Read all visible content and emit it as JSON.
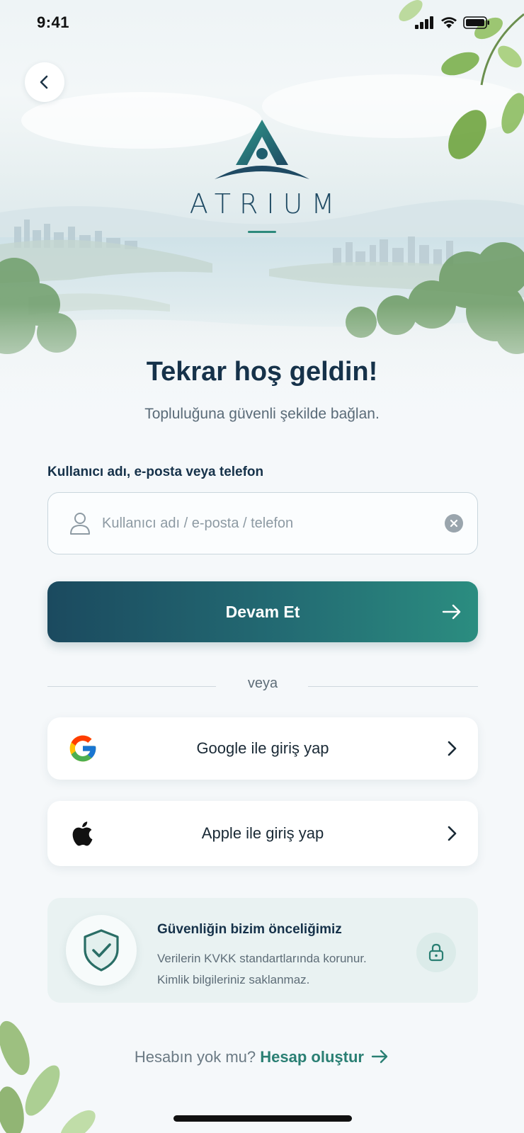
{
  "status_bar": {
    "time": "9:41"
  },
  "brand": {
    "name": "ATRIUM"
  },
  "welcome": {
    "title": "Tekrar hoş geldin!",
    "subtitle": "Topluluğuna güvenli şekilde bağlan."
  },
  "login_field": {
    "label": "Kullanıcı adı, e-posta veya telefon",
    "placeholder": "Kullanıcı adı / e-posta / telefon",
    "value": ""
  },
  "continue_button": {
    "label": "Devam Et"
  },
  "divider": {
    "text": "veya"
  },
  "social": {
    "google_label": "Google ile giriş yap",
    "apple_label": "Apple ile giriş yap"
  },
  "security": {
    "title": "Güvenliğin bizim önceliğimiz",
    "line1": "Verilerin KVKK standartlarında korunur.",
    "line2": "Kimlik bilgileriniz saklanmaz."
  },
  "signup": {
    "prompt": "Hesabın yok mu?",
    "link": "Hesap oluştur"
  },
  "colors": {
    "primary_dark": "#1b4a5f",
    "primary_teal": "#2b8d80",
    "text_dark": "#16324a",
    "card_bg": "#e9f2f2"
  },
  "icons": [
    "back-arrow",
    "user",
    "clear",
    "arrow-right",
    "google",
    "apple",
    "chevron-right",
    "shield-check",
    "lock",
    "signal",
    "wifi",
    "battery"
  ]
}
